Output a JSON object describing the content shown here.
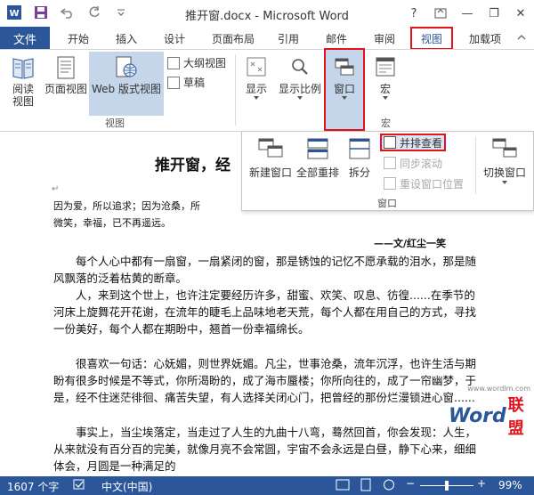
{
  "titlebar": {
    "title": "推开窗.docx - Microsoft Word",
    "help": "?",
    "minimize": "—",
    "restore": "❐",
    "close": "✕"
  },
  "qat": {
    "word_icon": "W",
    "save": "💾",
    "undo": "↶",
    "redo": "↻",
    "more": "⌄"
  },
  "tabs": {
    "file": "文件",
    "items": [
      "开始",
      "插入",
      "设计",
      "页面布局",
      "引用",
      "邮件",
      "审阅",
      "视图",
      "加载项"
    ]
  },
  "ribbon": {
    "read_mode": "阅读视图",
    "print_layout": "页面视图",
    "web_layout": "Web 版式视图",
    "outline": "大纲视图",
    "draft": "草稿",
    "views_group": "视图",
    "show": "显示",
    "zoom": "显示比例",
    "window": "窗口",
    "macro": "宏",
    "macro_group": "宏"
  },
  "window_panel": {
    "new_window": "新建窗口",
    "arrange_all": "全部重排",
    "split": "拆分",
    "view_side_by_side": "并排查看",
    "sync_scroll": "同步滚动",
    "reset_position": "重设窗口位置",
    "switch_windows": "切换窗口",
    "group_label": "窗口"
  },
  "document": {
    "title": "推开窗，经",
    "intro1": "因为爱，所以追求；因为沧桑，所",
    "intro2": "微笑，幸福，已不再遥远。",
    "signature": "——文/红尘一笑",
    "p1": "每个人心中都有一扇窗，一扇紧闭的窗，那是锈蚀的记忆不愿承载的泪水，那是随风飘落的泛着枯黄的断章。",
    "p2": "人，来到这个世上，也许注定要经历许多，甜蜜、欢笑、叹息、彷徨......在季节的河床上旋舞花开花谢，在流年的睫毛上品味地老天荒，每个人都在用自己的方式，寻找一份美好，每个人都在期盼中，翘首一份幸福绵长。",
    "p3": "很喜欢一句话：心妩媚，则世界妩媚。凡尘，世事沧桑，流年沉浮，也许生活与期盼有很多时候是不等式，你所渴盼的，成了海市蜃楼；你所向往的，成了一帘幽梦，于是，经不住迷茫徘徊、痛苦失望，有人选择关闭心门，把曾经的那份烂漫锁进心窗......",
    "p4": "事实上，当尘埃落定，当走过了人生的九曲十八弯，蓦然回首，你会发现：人生，从来就没有百分百的完美，就像月亮不会常圆，宇宙不会永远是白昼，静下心来，细细体会，月圆是一种满足的"
  },
  "statusbar": {
    "word_count": "1607 个字",
    "language": "中文(中国)",
    "zoom": "99%"
  },
  "watermark": {
    "site": "www.wordlm.com",
    "brand_word": "Word",
    "brand_cn": "联盟"
  },
  "colors": {
    "accent": "#2b579a",
    "highlight": "#e0141e"
  }
}
